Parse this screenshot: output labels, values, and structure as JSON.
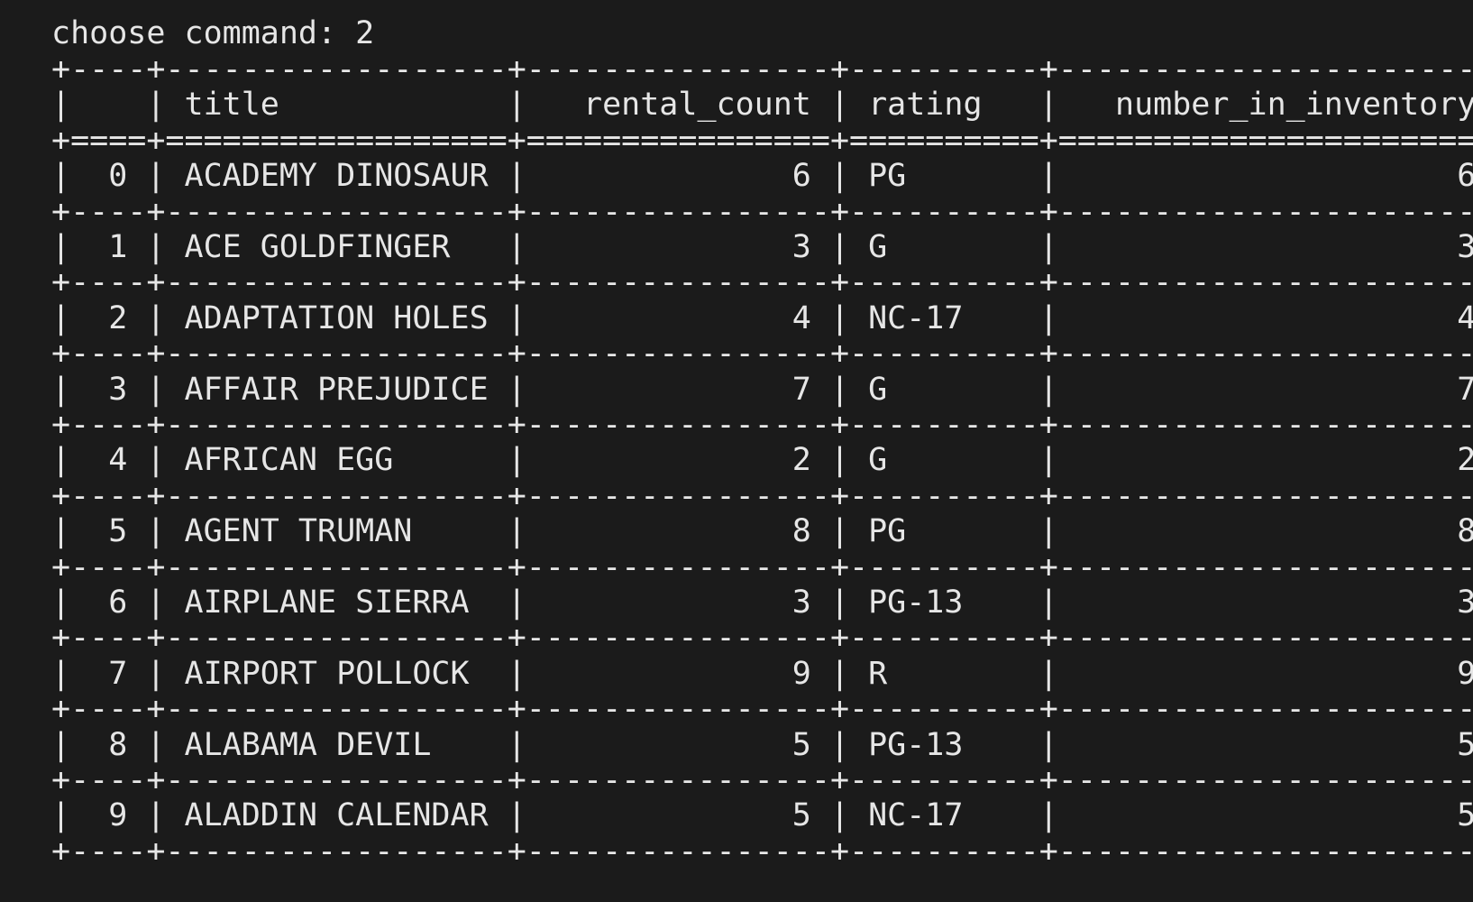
{
  "terminal": {
    "prompt_label": "choose command:",
    "prompt_value": "2"
  },
  "table": {
    "columns": [
      "",
      "title",
      "rental_count",
      "rating",
      "number_in_inventory"
    ],
    "rows": [
      {
        "index": "0",
        "title": "ACADEMY DINOSAUR",
        "rental_count": "6",
        "rating": "PG",
        "number_in_inventory": "6"
      },
      {
        "index": "1",
        "title": "ACE GOLDFINGER",
        "rental_count": "3",
        "rating": "G",
        "number_in_inventory": "3"
      },
      {
        "index": "2",
        "title": "ADAPTATION HOLES",
        "rental_count": "4",
        "rating": "NC-17",
        "number_in_inventory": "4"
      },
      {
        "index": "3",
        "title": "AFFAIR PREJUDICE",
        "rental_count": "7",
        "rating": "G",
        "number_in_inventory": "7"
      },
      {
        "index": "4",
        "title": "AFRICAN EGG",
        "rental_count": "2",
        "rating": "G",
        "number_in_inventory": "2"
      },
      {
        "index": "5",
        "title": "AGENT TRUMAN",
        "rental_count": "8",
        "rating": "PG",
        "number_in_inventory": "8"
      },
      {
        "index": "6",
        "title": "AIRPLANE SIERRA",
        "rental_count": "3",
        "rating": "PG-13",
        "number_in_inventory": "3"
      },
      {
        "index": "7",
        "title": "AIRPORT POLLOCK",
        "rental_count": "9",
        "rating": "R",
        "number_in_inventory": "9"
      },
      {
        "index": "8",
        "title": "ALABAMA DEVIL",
        "rental_count": "5",
        "rating": "PG-13",
        "number_in_inventory": "5"
      },
      {
        "index": "9",
        "title": "ALADDIN CALENDAR",
        "rental_count": "5",
        "rating": "NC-17",
        "number_in_inventory": "5"
      }
    ]
  }
}
